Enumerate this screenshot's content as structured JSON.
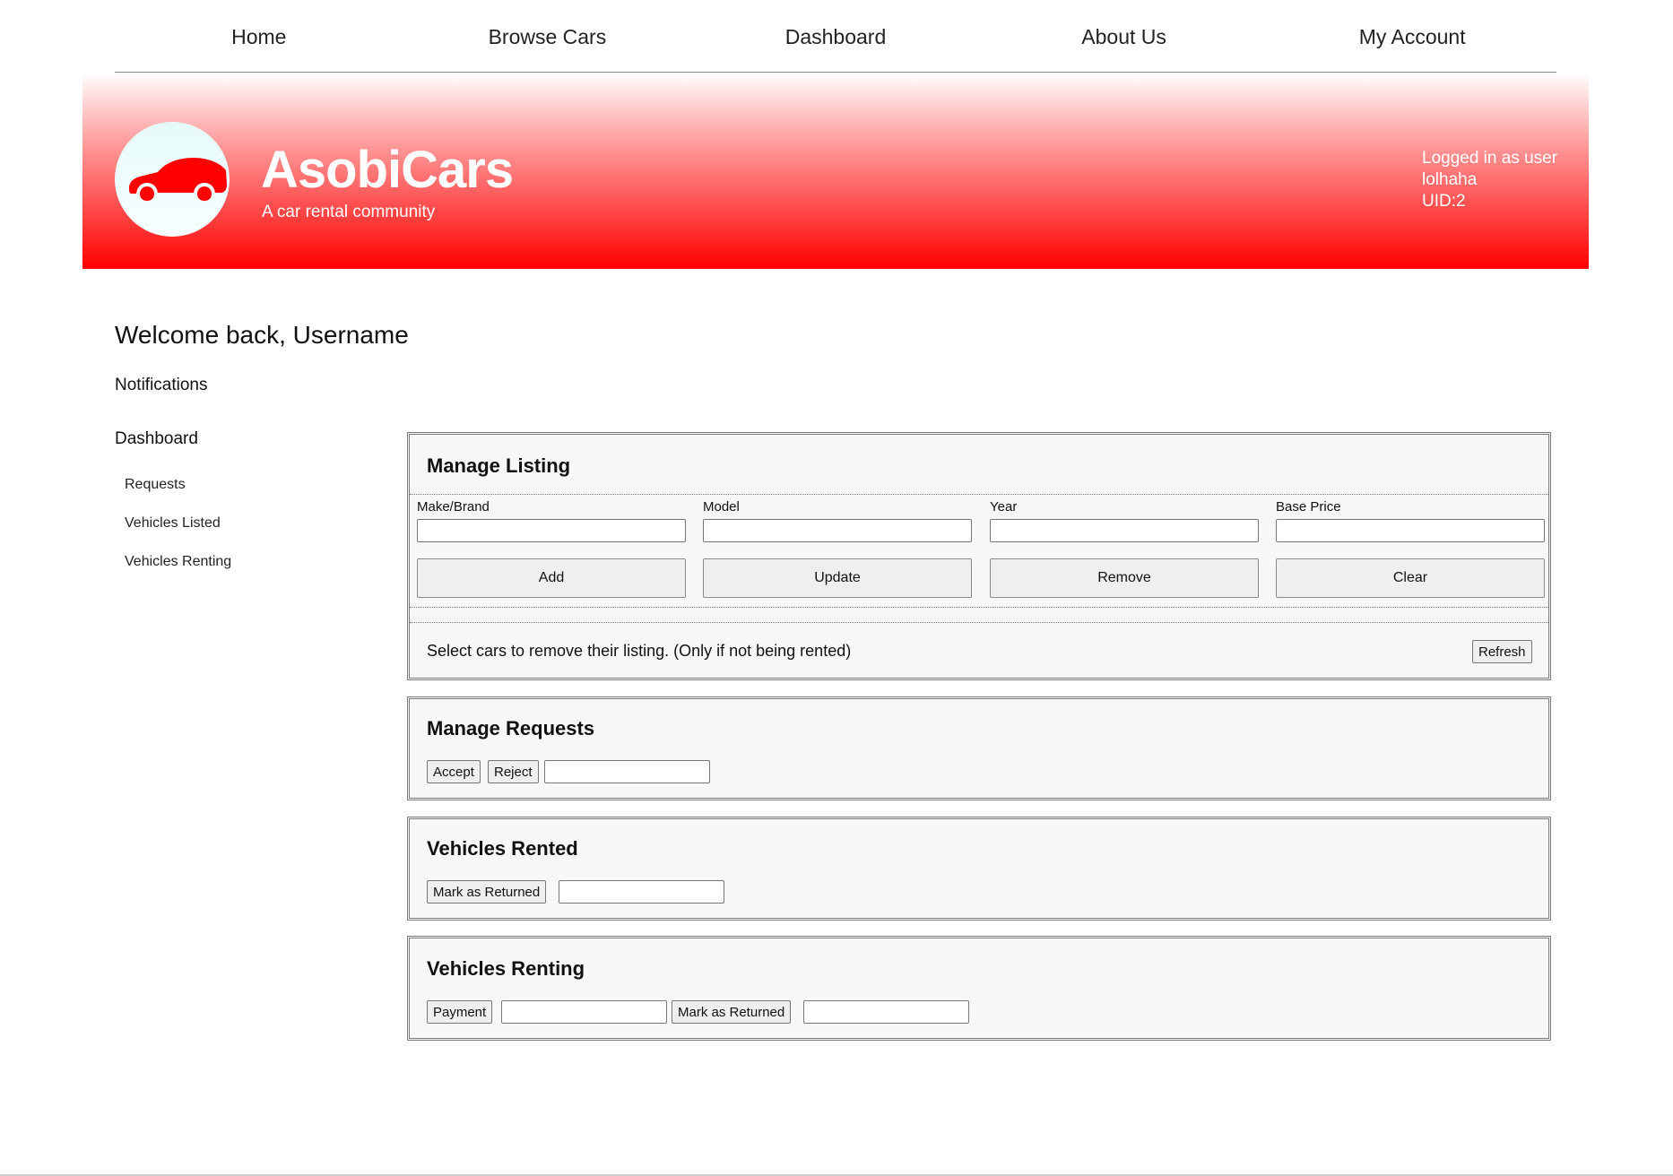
{
  "nav": {
    "home": "Home",
    "browse": "Browse Cars",
    "dashboard": "Dashboard",
    "about": "About Us",
    "account": "My Account"
  },
  "brand": {
    "title": "AsobiCars",
    "subtitle": "A car rental community",
    "logo_icon": "car-silhouette-icon",
    "accent": "#ff0000"
  },
  "login": {
    "line1": "Logged in as user",
    "line2": "lolhaha",
    "line3": "UID:2"
  },
  "welcome": "Welcome back, Username",
  "sidebar": {
    "notifications": "Notifications",
    "dashboard": "Dashboard",
    "items": [
      {
        "label": "Requests"
      },
      {
        "label": "Vehicles Listed"
      },
      {
        "label": "Vehicles Renting"
      }
    ]
  },
  "manage_listing": {
    "title": "Manage Listing",
    "fields": [
      {
        "label": "Make/Brand",
        "value": ""
      },
      {
        "label": "Model",
        "value": ""
      },
      {
        "label": "Year",
        "value": ""
      },
      {
        "label": "Base Price",
        "value": ""
      }
    ],
    "buttons": {
      "add": "Add",
      "update": "Update",
      "remove": "Remove",
      "clear": "Clear"
    },
    "note": "Select cars to remove their listing. (Only if not being rented)",
    "refresh": "Refresh"
  },
  "manage_requests": {
    "title": "Manage Requests",
    "accept": "Accept",
    "reject": "Reject",
    "input_value": ""
  },
  "vehicles_rented": {
    "title": "Vehicles Rented",
    "mark_returned": "Mark as Returned",
    "input_value": ""
  },
  "vehicles_renting": {
    "title": "Vehicles Renting",
    "payment": "Payment",
    "mark_returned": "Mark as Returned",
    "payment_input_value": "",
    "returned_input_value": ""
  }
}
